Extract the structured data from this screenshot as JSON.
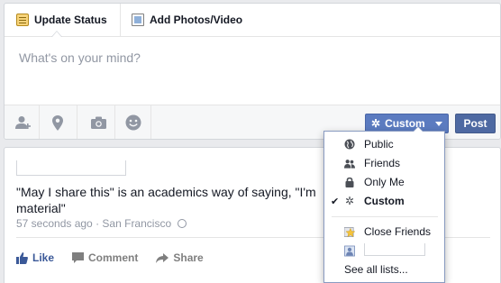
{
  "composer": {
    "tabs": [
      {
        "label": "Update Status",
        "icon": "status-icon"
      },
      {
        "label": "Add Photos/Video",
        "icon": "photo-icon"
      }
    ],
    "placeholder": "What's on your mind?",
    "toolbar": {
      "icons": [
        "tag-friends-icon",
        "location-icon",
        "camera-icon",
        "feeling-icon"
      ],
      "audience_label": "Custom",
      "post_label": "Post"
    }
  },
  "post": {
    "text": "\"May I share this\" is an academics way of saying, \"I'm",
    "text_line2": "material\"",
    "time": "57 seconds ago",
    "separator": "·",
    "location": "San Francisco",
    "actions": [
      "Like",
      "Comment",
      "Share"
    ]
  },
  "audience_menu": {
    "items": [
      {
        "label": "Public",
        "icon": "globe-icon",
        "checked": false
      },
      {
        "label": "Friends",
        "icon": "friends-icon",
        "checked": false
      },
      {
        "label": "Only Me",
        "icon": "lock-icon",
        "checked": false
      },
      {
        "label": "Custom",
        "icon": "gear-icon",
        "checked": true
      }
    ],
    "lists": [
      {
        "label": "Close Friends",
        "icon": "star-icon"
      }
    ],
    "see_all": "See all lists...",
    "check_mark": "✔"
  },
  "colors": {
    "brand_blue": "#4e69a2",
    "audience_blue": "#5b7bc0",
    "link_blue": "#3b5998",
    "muted_text": "#9197a3"
  }
}
